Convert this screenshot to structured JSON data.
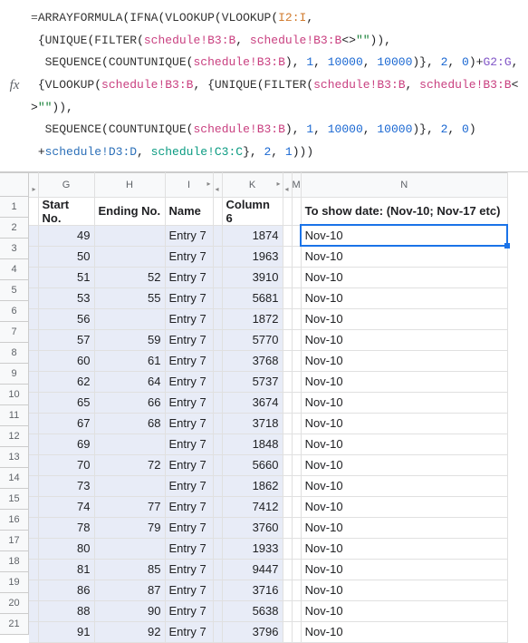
{
  "fx_label": "fx",
  "formula": {
    "line1_pre": "=",
    "line1_f1": "ARRAYFORMULA",
    "line1_p1": "(",
    "line1_f2": "IFNA",
    "line1_p2": "(",
    "line1_f3": "VLOOKUP",
    "line1_p3": "(",
    "line1_f4": "VLOOKUP",
    "line1_p4": "(",
    "line1_ref": "I2:I",
    "line1_end": ",",
    "line2_b": " {",
    "line2_f1": "UNIQUE",
    "line2_p1": "(",
    "line2_f2": "FILTER",
    "line2_p2": "(",
    "line2_r1": "schedule!B3:B",
    "line2_c1": ", ",
    "line2_r2": "schedule!B3:B",
    "line2_ne": "<>",
    "line2_q": "\"\"",
    "line2_pp": ")),",
    "line3_sp": "  ",
    "line3_f1": "SEQUENCE",
    "line3_p1": "(",
    "line3_f2": "COUNTUNIQUE",
    "line3_p2": "(",
    "line3_r1": "schedule!B3:B",
    "line3_cp": "), ",
    "line3_n1": "1",
    "line3_c1": ", ",
    "line3_n2": "10000",
    "line3_c2": ", ",
    "line3_n3": "10000",
    "line3_pp": ")}, ",
    "line3_n4": "2",
    "line3_c3": ", ",
    "line3_n5": "0",
    "line3_cp2": ")",
    "line3_plus": "+",
    "line3_r2": "G2:G",
    "line3_end": ",",
    "line4_b": " {",
    "line4_f1": "VLOOKUP",
    "line4_p1": "(",
    "line4_r1": "schedule!B3:B",
    "line4_c1": ", {",
    "line4_f2": "UNIQUE",
    "line4_p2": "(",
    "line4_f3": "FILTER",
    "line4_p3": "(",
    "line4_r2": "schedule!B3:B",
    "line4_c2": ", ",
    "line4_r3": "schedule!B3:B",
    "line4_ne": "<>",
    "line4_q": "\"\"",
    "line4_pp": ")),",
    "line5_sp": "  ",
    "line5_f1": "SEQUENCE",
    "line5_p1": "(",
    "line5_f2": "COUNTUNIQUE",
    "line5_p2": "(",
    "line5_r1": "schedule!B3:B",
    "line5_cp": "), ",
    "line5_n1": "1",
    "line5_c1": ", ",
    "line5_n2": "10000",
    "line5_c2": ", ",
    "line5_n3": "10000",
    "line5_pp": ")}, ",
    "line5_n4": "2",
    "line5_c3": ", ",
    "line5_n5": "0",
    "line5_cp2": ")",
    "line6_sp": " +",
    "line6_r1": "schedule!D3:D",
    "line6_c1": ", ",
    "line6_r2": "schedule!C3:C",
    "line6_pp": "}, ",
    "line6_n1": "2",
    "line6_c2": ", ",
    "line6_n2": "1",
    "line6_end": ")))"
  },
  "columns": [
    "G",
    "H",
    "I",
    "K",
    "M",
    "N"
  ],
  "col_arrows": {
    "G": "left",
    "I": "right_both",
    "K": "both",
    "M": "left"
  },
  "row_numbers": [
    "1",
    "2",
    "3",
    "4",
    "5",
    "6",
    "7",
    "8",
    "9",
    "10",
    "11",
    "12",
    "13",
    "14",
    "15",
    "16",
    "17",
    "18",
    "19",
    "20",
    "21"
  ],
  "headers": {
    "G": "Start No.",
    "H": "Ending No.",
    "I": "Name",
    "K": "Column 6",
    "N": "To show date: (Nov-10; Nov-17 etc)"
  },
  "chart_data": {
    "type": "table",
    "columns": [
      "Start No.",
      "Ending No.",
      "Name",
      "Column 6",
      "To show date"
    ],
    "rows": [
      {
        "start": 49,
        "end": "",
        "name": "Entry 7",
        "col6": 1874,
        "date": "Nov-10"
      },
      {
        "start": 50,
        "end": "",
        "name": "Entry 7",
        "col6": 1963,
        "date": "Nov-10"
      },
      {
        "start": 51,
        "end": 52,
        "name": "Entry 7",
        "col6": 3910,
        "date": "Nov-10"
      },
      {
        "start": 53,
        "end": 55,
        "name": "Entry 7",
        "col6": 5681,
        "date": "Nov-10"
      },
      {
        "start": 56,
        "end": "",
        "name": "Entry 7",
        "col6": 1872,
        "date": "Nov-10"
      },
      {
        "start": 57,
        "end": 59,
        "name": "Entry 7",
        "col6": 5770,
        "date": "Nov-10"
      },
      {
        "start": 60,
        "end": 61,
        "name": "Entry 7",
        "col6": 3768,
        "date": "Nov-10"
      },
      {
        "start": 62,
        "end": 64,
        "name": "Entry 7",
        "col6": 5737,
        "date": "Nov-10"
      },
      {
        "start": 65,
        "end": 66,
        "name": "Entry 7",
        "col6": 3674,
        "date": "Nov-10"
      },
      {
        "start": 67,
        "end": 68,
        "name": "Entry 7",
        "col6": 3718,
        "date": "Nov-10"
      },
      {
        "start": 69,
        "end": "",
        "name": "Entry 7",
        "col6": 1848,
        "date": "Nov-10"
      },
      {
        "start": 70,
        "end": 72,
        "name": "Entry 7",
        "col6": 5660,
        "date": "Nov-10"
      },
      {
        "start": 73,
        "end": "",
        "name": "Entry 7",
        "col6": 1862,
        "date": "Nov-10"
      },
      {
        "start": 74,
        "end": 77,
        "name": "Entry 7",
        "col6": 7412,
        "date": "Nov-10"
      },
      {
        "start": 78,
        "end": 79,
        "name": "Entry 7",
        "col6": 3760,
        "date": "Nov-10"
      },
      {
        "start": 80,
        "end": "",
        "name": "Entry 7",
        "col6": 1933,
        "date": "Nov-10"
      },
      {
        "start": 81,
        "end": 85,
        "name": "Entry 7",
        "col6": 9447,
        "date": "Nov-10"
      },
      {
        "start": 86,
        "end": 87,
        "name": "Entry 7",
        "col6": 3716,
        "date": "Nov-10"
      },
      {
        "start": 88,
        "end": 90,
        "name": "Entry 7",
        "col6": 5638,
        "date": "Nov-10"
      },
      {
        "start": 91,
        "end": 92,
        "name": "Entry 7",
        "col6": 3796,
        "date": "Nov-10"
      }
    ]
  }
}
